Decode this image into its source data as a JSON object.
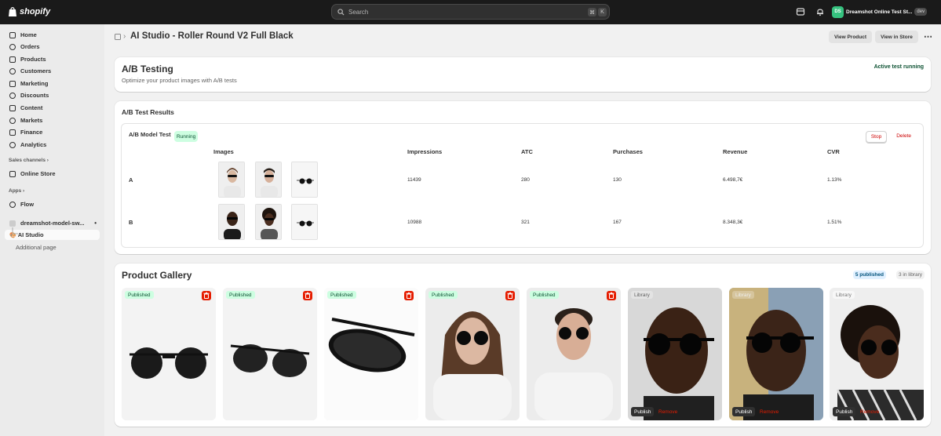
{
  "topbar": {
    "brand": "shopify",
    "search_placeholder": "Search",
    "shortcut_keys": [
      "⌘",
      "K"
    ],
    "store_initials": "DS",
    "store_name": "Dreamshot Online Test St...",
    "store_badge": "dev"
  },
  "sidebar": {
    "items": [
      {
        "label": "Home",
        "icon": "home-icon"
      },
      {
        "label": "Orders",
        "icon": "orders-icon"
      },
      {
        "label": "Products",
        "icon": "tag-icon"
      },
      {
        "label": "Customers",
        "icon": "person-icon"
      },
      {
        "label": "Marketing",
        "icon": "target-icon"
      },
      {
        "label": "Discounts",
        "icon": "discount-icon"
      },
      {
        "label": "Content",
        "icon": "content-icon"
      },
      {
        "label": "Markets",
        "icon": "globe-icon"
      },
      {
        "label": "Finance",
        "icon": "bank-icon"
      },
      {
        "label": "Analytics",
        "icon": "chart-icon"
      }
    ],
    "sales_channels_label": "Sales channels",
    "online_store": "Online Store",
    "apps_label": "Apps",
    "flow": "Flow",
    "app_name": "dreamshot-model-sw...",
    "ai_studio": "AI Studio",
    "additional_page": "Additional page"
  },
  "page": {
    "title": "AI Studio - Roller Round V2 Full Black",
    "view_product": "View Product",
    "view_in_store": "View in Store"
  },
  "ab_header": {
    "title": "A/B Testing",
    "subtitle": "Optimize your product images with A/B tests",
    "status": "Active test running"
  },
  "results": {
    "title": "A/B Test Results",
    "test_name": "A/B Model Test",
    "test_status": "Running",
    "stop": "Stop",
    "delete": "Delete",
    "columns": [
      "Images",
      "Impressions",
      "ATC",
      "Purchases",
      "Revenue",
      "CVR"
    ],
    "rows": [
      {
        "variant": "A",
        "impressions": "11439",
        "atc": "280",
        "purchases": "130",
        "revenue": "6.498,7€",
        "cvr": "1.13%"
      },
      {
        "variant": "B",
        "impressions": "10988",
        "atc": "321",
        "purchases": "167",
        "revenue": "8.348,3€",
        "cvr": "1.51%"
      }
    ]
  },
  "gallery": {
    "title": "Product Gallery",
    "published_count": "5 published",
    "library_count": "3 in library",
    "items": [
      {
        "badge": "Published"
      },
      {
        "badge": "Published"
      },
      {
        "badge": "Published"
      },
      {
        "badge": "Published"
      },
      {
        "badge": "Published"
      },
      {
        "badge": "Library",
        "publish": "Publish",
        "remove": "Remove"
      },
      {
        "badge": "Library",
        "publish": "Publish",
        "remove": "Remove"
      },
      {
        "badge": "Library",
        "publish": "Publish",
        "remove": "Remove"
      }
    ]
  },
  "colors": {
    "accent_green": "#0c5132",
    "danger": "#e51c00",
    "topbar": "#1a1a1a"
  }
}
